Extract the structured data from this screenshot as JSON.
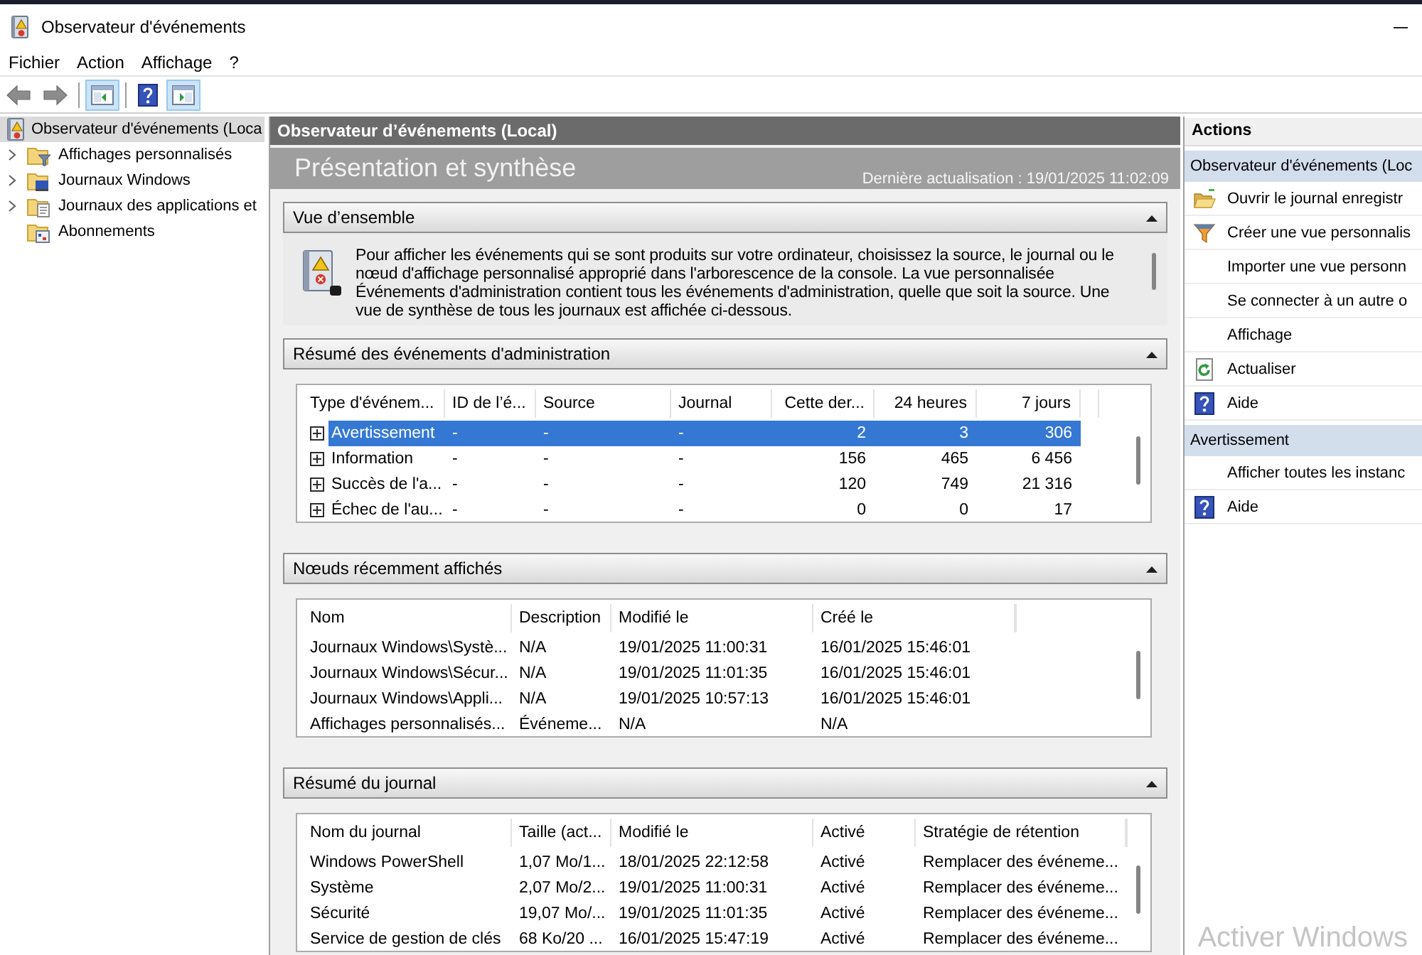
{
  "window": {
    "title": "Observateur d'événements"
  },
  "menu": [
    {
      "label": "Fichier"
    },
    {
      "label": "Action"
    },
    {
      "label": "Affichage"
    },
    {
      "label": "?"
    }
  ],
  "toolbar": [
    [
      {
        "kind": "back",
        "on": false
      },
      {
        "kind": "forward",
        "on": false
      }
    ],
    [
      {
        "kind": "tree_pane",
        "on": true
      }
    ],
    [
      {
        "kind": "help",
        "on": false
      },
      {
        "kind": "action_pane",
        "on": true
      }
    ]
  ],
  "tree": {
    "label": "Observateur d'événements (Loca",
    "selected": true,
    "children": [
      {
        "label": "Affichages personnalisés",
        "selected": false,
        "expandable": true
      },
      {
        "label": "Journaux Windows",
        "selected": false,
        "expandable": true
      },
      {
        "label": "Journaux des applications et",
        "selected": false,
        "expandable": true
      },
      {
        "label": "Abonnements",
        "selected": false,
        "expandable": false
      }
    ]
  },
  "center": {
    "header": "Observateur d’événements (Local)",
    "banner": {
      "title": "Présentation et synthèse",
      "updated": "Dernière actualisation : 19/01/2025 11:02:09"
    },
    "sections": [
      {
        "kind": "text",
        "title": "Vue d’ensemble",
        "expanded": true,
        "text": "Pour afficher les événements qui se sont produits sur votre ordinateur, choisissez la source, le journal ou le nœud d'affichage personnalisé approprié dans l'arborescence de la console. La vue personnalisée Événements d'administration contient tous les événements d'administration, quelle que soit la source. Une vue de synthèse de tous les journaux est affichée ci-dessous."
      },
      {
        "kind": "table",
        "title": "Résumé des événements d'administration",
        "expanded": true,
        "columns": [
          {
            "label": "Type d'événem...",
            "kind": "text"
          },
          {
            "label": "ID de l’é...",
            "kind": "text"
          },
          {
            "label": "Source",
            "kind": "text"
          },
          {
            "label": "Journal",
            "kind": "text"
          },
          {
            "label": "Cette der...",
            "kind": "number"
          },
          {
            "label": "24 heures",
            "kind": "number"
          },
          {
            "label": "7 jours",
            "kind": "number"
          }
        ],
        "rows": [
          {
            "selected": true,
            "expanded": false,
            "cells": [
              "Avertissement",
              "-",
              "-",
              "-",
              "2",
              "3",
              "306"
            ]
          },
          {
            "selected": false,
            "expanded": false,
            "cells": [
              "Information",
              "-",
              "-",
              "-",
              "156",
              "465",
              "6 456"
            ]
          },
          {
            "selected": false,
            "expanded": false,
            "cells": [
              "Succès de l'a...",
              "-",
              "-",
              "-",
              "120",
              "749",
              "21 316"
            ]
          },
          {
            "selected": false,
            "expanded": false,
            "cells": [
              "Échec de l'au...",
              "-",
              "-",
              "-",
              "0",
              "0",
              "17"
            ]
          }
        ]
      },
      {
        "kind": "table",
        "title": "Nœuds récemment affichés",
        "expanded": true,
        "columns": [
          {
            "label": "Nom",
            "kind": "text"
          },
          {
            "label": "Description",
            "kind": "text"
          },
          {
            "label": "Modifié le",
            "kind": "text"
          },
          {
            "label": "Créé le",
            "kind": "text"
          }
        ],
        "rows": [
          {
            "selected": false,
            "cells": [
              "Journaux Windows\\Systè...",
              "N/A",
              "19/01/2025 11:00:31",
              "16/01/2025 15:46:01"
            ]
          },
          {
            "selected": false,
            "cells": [
              "Journaux Windows\\Sécur...",
              "N/A",
              "19/01/2025 11:01:35",
              "16/01/2025 15:46:01"
            ]
          },
          {
            "selected": false,
            "cells": [
              "Journaux Windows\\Appli...",
              "N/A",
              "19/01/2025 10:57:13",
              "16/01/2025 15:46:01"
            ]
          },
          {
            "selected": false,
            "cells": [
              "Affichages personnalisés...",
              "Événeme...",
              "N/A",
              "N/A"
            ]
          }
        ]
      },
      {
        "kind": "table",
        "title": "Résumé du journal",
        "expanded": true,
        "columns": [
          {
            "label": "Nom du journal",
            "kind": "text"
          },
          {
            "label": "Taille (act...",
            "kind": "text"
          },
          {
            "label": "Modifié le",
            "kind": "text"
          },
          {
            "label": "Activé",
            "kind": "text"
          },
          {
            "label": "Stratégie de rétention",
            "kind": "text"
          }
        ],
        "rows": [
          {
            "selected": false,
            "cells": [
              "Windows PowerShell",
              "1,07 Mo/1...",
              "18/01/2025 22:12:58",
              "Activé",
              "Remplacer des événeme..."
            ]
          },
          {
            "selected": false,
            "cells": [
              "Système",
              "2,07 Mo/2...",
              "19/01/2025 11:00:31",
              "Activé",
              "Remplacer des événeme..."
            ]
          },
          {
            "selected": false,
            "cells": [
              "Sécurité",
              "19,07 Mo/...",
              "19/01/2025 11:01:35",
              "Activé",
              "Remplacer des événeme..."
            ]
          },
          {
            "selected": false,
            "cells": [
              "Service de gestion de clés",
              "68 Ko/20 ...",
              "16/01/2025 15:47:19",
              "Activé",
              "Remplacer des événeme..."
            ]
          }
        ]
      }
    ]
  },
  "actions": {
    "title": "Actions",
    "groups": [
      {
        "title": "Observateur d'événements (Loc",
        "items": [
          "Ouvrir le journal enregistr",
          "Créer une vue personnalis",
          "Importer une vue personn",
          "Se connecter à un autre o",
          "Affichage",
          "Actualiser",
          "Aide"
        ]
      },
      {
        "title": "Avertissement",
        "items": [
          "Afficher toutes les instanc",
          "Aide"
        ]
      }
    ]
  },
  "activation_notice": "Activer Windows"
}
